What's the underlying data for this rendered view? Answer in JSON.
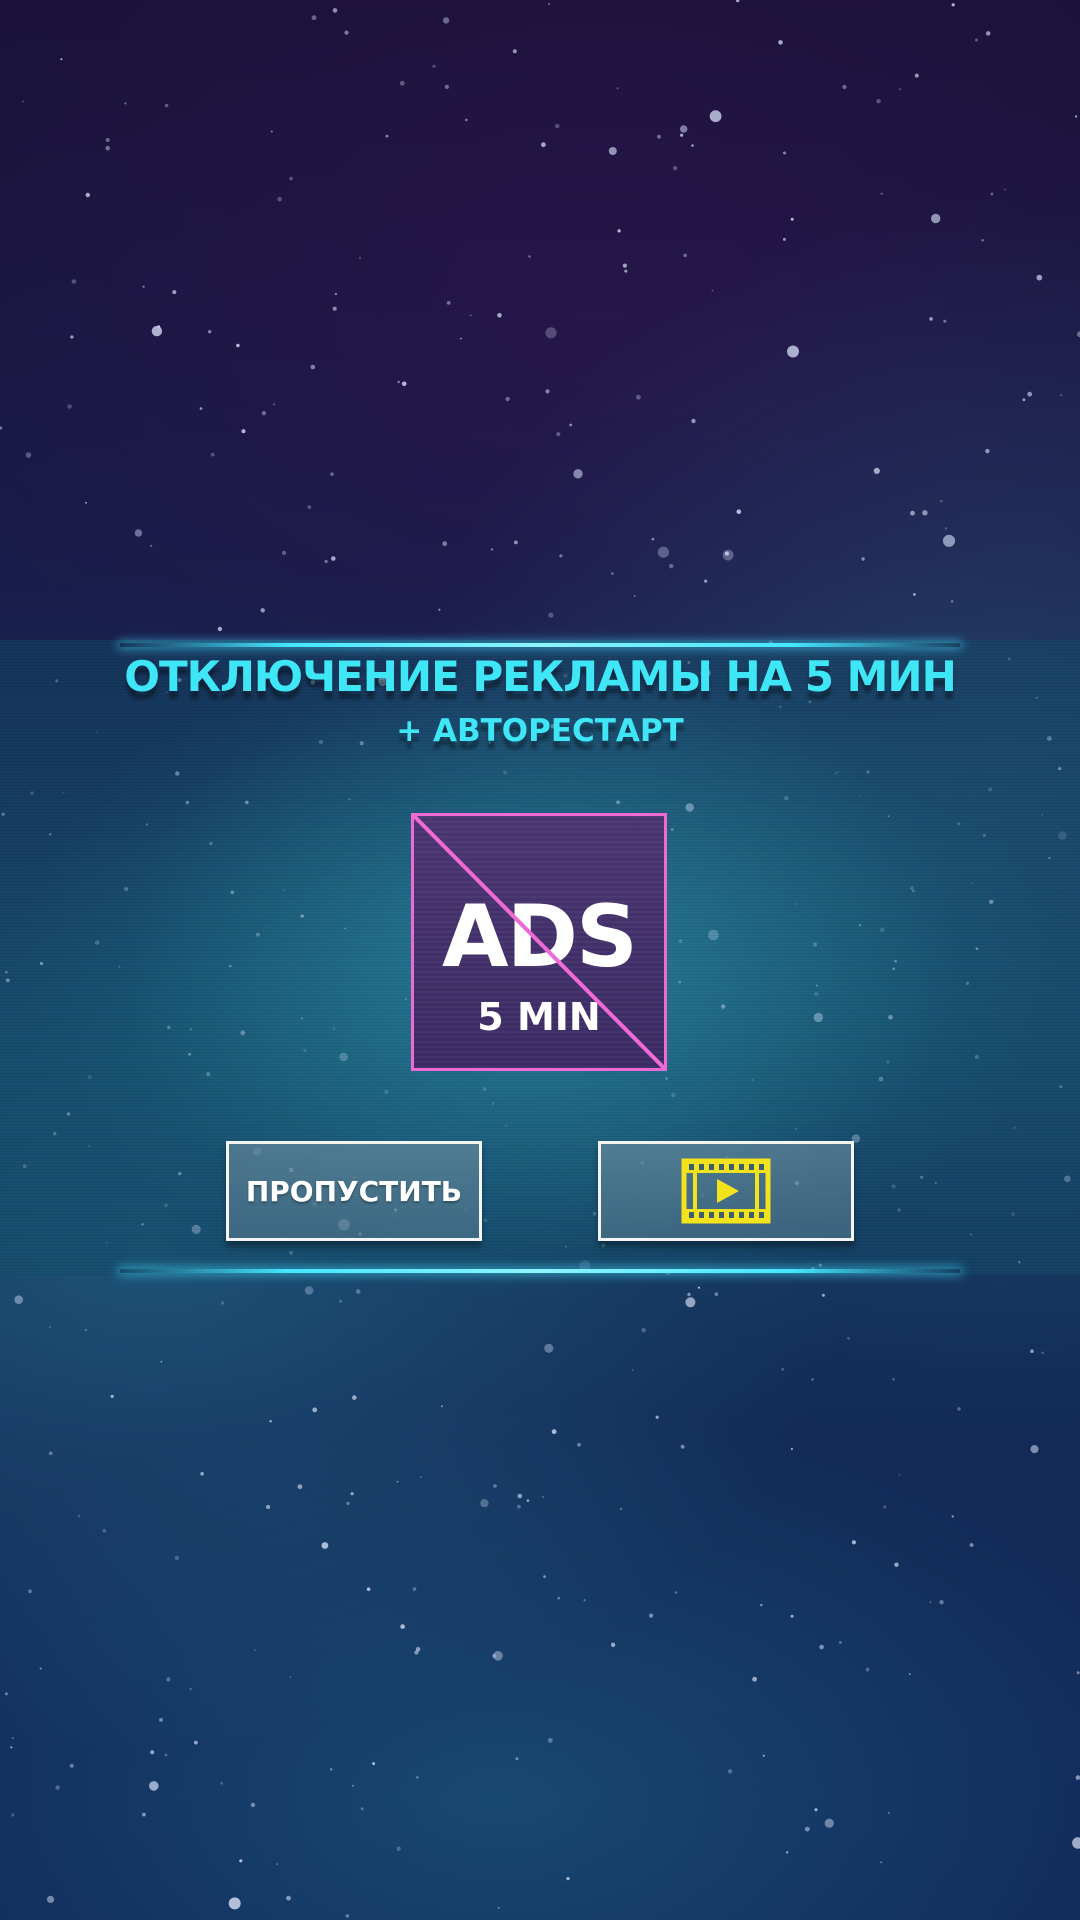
{
  "dialog": {
    "title": "ОТКЛЮЧЕНИЕ РЕКЛАМЫ НА 5 МИН",
    "subtitle": "+ АВТОРЕСТАРТ"
  },
  "ads_icon": {
    "main_text": "ADS",
    "duration_text": "5 MIN",
    "border_color": "#f06ad6"
  },
  "buttons": {
    "skip_label": "ПРОПУСТИТЬ",
    "watch_icon": "video-play-icon"
  },
  "colors": {
    "accent": "#3fe6f6",
    "icon_yellow": "#f3e21c",
    "glow_line": "#45e6ff"
  }
}
